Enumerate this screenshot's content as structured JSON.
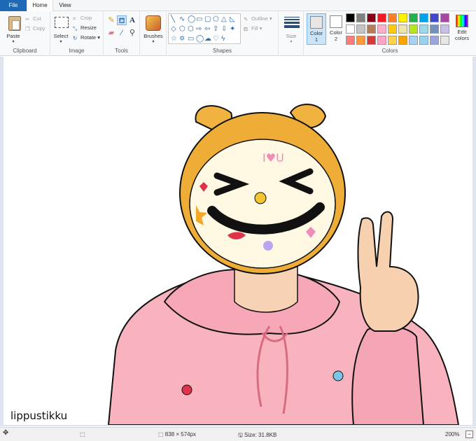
{
  "tabs": {
    "file": "File",
    "home": "Home",
    "view": "View"
  },
  "clipboard": {
    "paste": "Paste",
    "cut": "Cut",
    "copy": "Copy",
    "label": "Clipboard"
  },
  "image": {
    "select": "Select",
    "crop": "Crop",
    "resize": "Resize",
    "rotate": "Rotate",
    "label": "Image"
  },
  "tools": {
    "label": "Tools",
    "active_tool": "select-icon"
  },
  "brushes": {
    "label": "Brushes"
  },
  "shapes": {
    "outline": "Outline",
    "fill": "Fill",
    "label": "Shapes"
  },
  "size": {
    "label": "Size"
  },
  "colors": {
    "color1_label": "Color",
    "color1_num": "1",
    "color2_label": "Color",
    "color2_num": "2",
    "edit_label": "Edit",
    "edit_label2": "colors",
    "label": "Colors",
    "color1": "#e6e6e6",
    "color2": "#ffffff",
    "palette_row1": [
      "#000000",
      "#7f7f7f",
      "#880015",
      "#ed1c24",
      "#ff7f27",
      "#fff200",
      "#22b14c",
      "#00a2e8",
      "#3f48cc",
      "#a349a4"
    ],
    "palette_row2": [
      "#ffffff",
      "#c3c3c3",
      "#b97a57",
      "#ffaec9",
      "#ffc90e",
      "#efe4b0",
      "#b5e61d",
      "#99d9ea",
      "#7092be",
      "#c8bfe7"
    ],
    "palette_row3": [
      "#ff7a7a",
      "#ff9a3c",
      "#d43a3a",
      "#ffa5c8",
      "#ffd24a",
      "#f7a400",
      "#a5d3f5",
      "#9ad1f0",
      "#9aa6e0",
      "#e6e6e6"
    ]
  },
  "canvas": {
    "watermark": "lippustikku"
  },
  "status": {
    "dimensions": "838 × 574px",
    "size": "Size: 31.8KB",
    "zoom": "200%"
  }
}
